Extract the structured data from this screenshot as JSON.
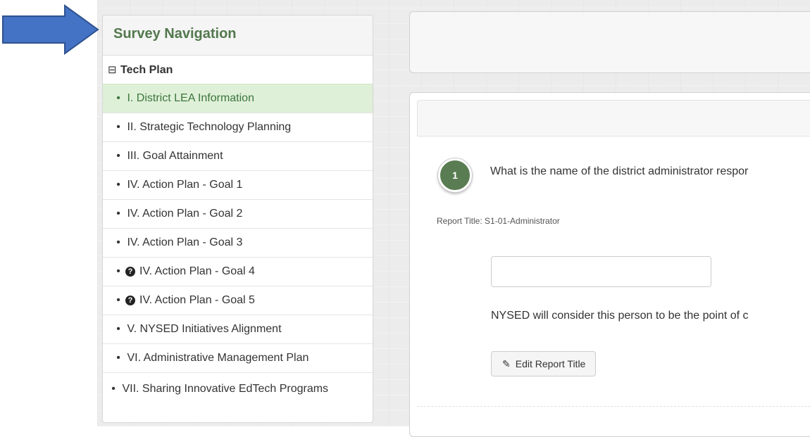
{
  "navigation": {
    "heading": "Survey Navigation",
    "root": {
      "collapse_icon": "⊟",
      "label": "Tech Plan"
    },
    "items": [
      {
        "label": "I. District LEA Information",
        "active": true,
        "help": false
      },
      {
        "label": "II. Strategic Technology Planning",
        "active": false,
        "help": false
      },
      {
        "label": "III. Goal Attainment",
        "active": false,
        "help": false
      },
      {
        "label": "IV. Action Plan - Goal 1",
        "active": false,
        "help": false
      },
      {
        "label": "IV. Action Plan - Goal 2",
        "active": false,
        "help": false
      },
      {
        "label": "IV. Action Plan - Goal 3",
        "active": false,
        "help": false
      },
      {
        "label": "IV. Action Plan - Goal 4",
        "active": false,
        "help": true
      },
      {
        "label": "IV. Action Plan - Goal 5",
        "active": false,
        "help": true
      },
      {
        "label": "V. NYSED Initiatives Alignment",
        "active": false,
        "help": false
      },
      {
        "label": "VI. Administrative Management Plan",
        "active": false,
        "help": false
      },
      {
        "label": "VII. Sharing Innovative EdTech Programs",
        "active": false,
        "help": false
      }
    ],
    "bullet": "•",
    "help_glyph": "?"
  },
  "question": {
    "number": "1",
    "text": "What is the name of the district administrator respor",
    "report_title": "Report Title: S1-01-Administrator",
    "answer_value": "",
    "answer_placeholder": "",
    "note": "NYSED will consider this person to be the point of c",
    "edit_button_label": "Edit Report Title",
    "pencil_glyph": "✎"
  },
  "colors": {
    "heading_green": "#52784c",
    "active_bg": "#dff0d8",
    "badge_green": "#5a7c52",
    "arrow_blue": "#4472c4"
  },
  "icons": {
    "arrow": "arrow-right-icon",
    "collapse": "minus-square-icon",
    "help": "question-circle-icon",
    "pencil": "pencil-icon"
  }
}
